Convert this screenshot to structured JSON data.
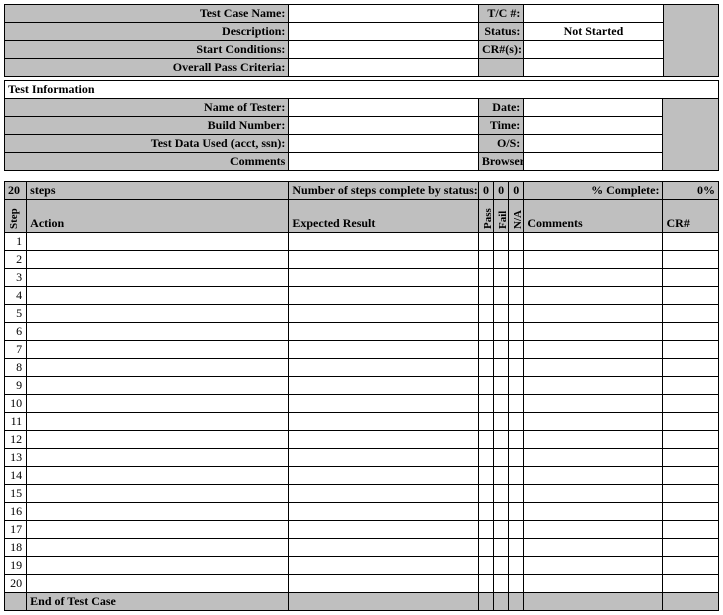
{
  "header1": {
    "test_case_name_label": "Test Case Name:",
    "test_case_name_value": "",
    "tc_num_label": "T/C #:",
    "tc_num_value": "",
    "description_label": "Description:",
    "description_value": "",
    "status_label": "Status:",
    "status_value": "Not Started",
    "start_conditions_label": "Start Conditions:",
    "start_conditions_value": "",
    "cr_nums_label": "CR#(s):",
    "cr_nums_value": "",
    "overall_pass_label": "Overall Pass Criteria:",
    "overall_pass_value": ""
  },
  "test_info": {
    "section_title": "Test Information",
    "name_of_tester_label": "Name of Tester:",
    "name_of_tester_value": "",
    "date_label": "Date:",
    "date_value": "",
    "build_number_label": "Build Number:",
    "build_number_value": "",
    "time_label": "Time:",
    "time_value": "",
    "test_data_label": "Test Data Used (acct, ssn):",
    "test_data_value": "",
    "os_label": "O/S:",
    "os_value": "",
    "comments_label": "Comments",
    "comments_value": "",
    "browser_label": "Browser:",
    "browser_value": ""
  },
  "summary": {
    "step_count": "20",
    "steps_word": "steps",
    "complete_by_status_label": "Number of steps complete by status:",
    "pass_count": "0",
    "fail_count": "0",
    "na_count": "0",
    "pct_complete_label": "% Complete:",
    "pct_complete_value": "0%"
  },
  "columns": {
    "step": "Step",
    "action": "Action",
    "expected": "Expected Result",
    "pass": "Pass",
    "fail": "Fail",
    "na": "N/A",
    "comments": "Comments",
    "cr": "CR#"
  },
  "steps": [
    {
      "n": "1"
    },
    {
      "n": "2"
    },
    {
      "n": "3"
    },
    {
      "n": "4"
    },
    {
      "n": "5"
    },
    {
      "n": "6"
    },
    {
      "n": "7"
    },
    {
      "n": "8"
    },
    {
      "n": "9"
    },
    {
      "n": "10"
    },
    {
      "n": "11"
    },
    {
      "n": "12"
    },
    {
      "n": "13"
    },
    {
      "n": "14"
    },
    {
      "n": "15"
    },
    {
      "n": "16"
    },
    {
      "n": "17"
    },
    {
      "n": "18"
    },
    {
      "n": "19"
    },
    {
      "n": "20"
    }
  ],
  "footer": {
    "end_label": "End of Test Case"
  }
}
